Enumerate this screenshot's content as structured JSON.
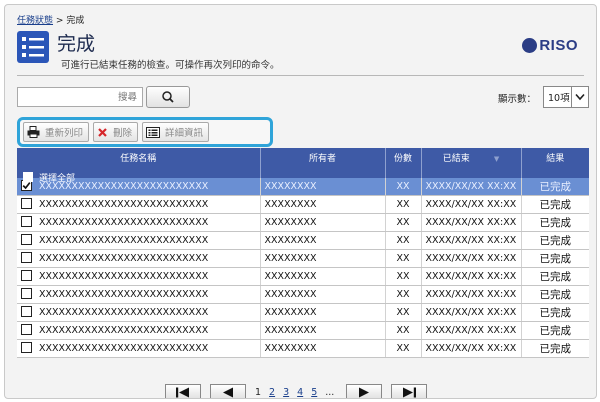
{
  "breadcrumb": {
    "parent": "任務狀態",
    "separator": ">",
    "current": "完成"
  },
  "header": {
    "title": "完成",
    "subtitle": "可進行已結束任務的檢查。可操作再次列印的命令。",
    "logo_text": "RISO",
    "icon": "list-check-icon"
  },
  "search": {
    "placeholder": "搜尋",
    "button_icon": "search-icon"
  },
  "display": {
    "label": "顯示數：",
    "value": "10項"
  },
  "toolbar": {
    "reprint": "重新列印",
    "delete": "刪除",
    "details": "詳細資訊"
  },
  "table": {
    "columns": {
      "name": "任務名稱",
      "owner": "所有者",
      "copies": "份數",
      "ended": "已結束",
      "result": "結果"
    },
    "select_all": "選擇全部",
    "rows": [
      {
        "name": "XXXXXXXXXXXXXXXXXXXXXXXXXX",
        "owner": "XXXXXXXX",
        "copies": "XX",
        "ended": "XXXX/XX/XX XX:XX",
        "result": "已完成",
        "checked": true,
        "selected": true
      },
      {
        "name": "XXXXXXXXXXXXXXXXXXXXXXXXXX",
        "owner": "XXXXXXXX",
        "copies": "XX",
        "ended": "XXXX/XX/XX XX:XX",
        "result": "已完成",
        "checked": false,
        "selected": false
      },
      {
        "name": "XXXXXXXXXXXXXXXXXXXXXXXXXX",
        "owner": "XXXXXXXX",
        "copies": "XX",
        "ended": "XXXX/XX/XX XX:XX",
        "result": "已完成",
        "checked": false,
        "selected": false
      },
      {
        "name": "XXXXXXXXXXXXXXXXXXXXXXXXXX",
        "owner": "XXXXXXXX",
        "copies": "XX",
        "ended": "XXXX/XX/XX XX:XX",
        "result": "已完成",
        "checked": false,
        "selected": false
      },
      {
        "name": "XXXXXXXXXXXXXXXXXXXXXXXXXX",
        "owner": "XXXXXXXX",
        "copies": "XX",
        "ended": "XXXX/XX/XX XX:XX",
        "result": "已完成",
        "checked": false,
        "selected": false
      },
      {
        "name": "XXXXXXXXXXXXXXXXXXXXXXXXXX",
        "owner": "XXXXXXXX",
        "copies": "XX",
        "ended": "XXXX/XX/XX XX:XX",
        "result": "已完成",
        "checked": false,
        "selected": false
      },
      {
        "name": "XXXXXXXXXXXXXXXXXXXXXXXXXX",
        "owner": "XXXXXXXX",
        "copies": "XX",
        "ended": "XXXX/XX/XX XX:XX",
        "result": "已完成",
        "checked": false,
        "selected": false
      },
      {
        "name": "XXXXXXXXXXXXXXXXXXXXXXXXXX",
        "owner": "XXXXXXXX",
        "copies": "XX",
        "ended": "XXXX/XX/XX XX:XX",
        "result": "已完成",
        "checked": false,
        "selected": false
      },
      {
        "name": "XXXXXXXXXXXXXXXXXXXXXXXXXX",
        "owner": "XXXXXXXX",
        "copies": "XX",
        "ended": "XXXX/XX/XX XX:XX",
        "result": "已完成",
        "checked": false,
        "selected": false
      },
      {
        "name": "XXXXXXXXXXXXXXXXXXXXXXXXXX",
        "owner": "XXXXXXXX",
        "copies": "XX",
        "ended": "XXXX/XX/XX XX:XX",
        "result": "已完成",
        "checked": false,
        "selected": false
      }
    ]
  },
  "pager": {
    "current": "1",
    "pages": [
      "2",
      "3",
      "4",
      "5"
    ],
    "ellipsis": "..."
  },
  "colors": {
    "header_blue": "#3e5aa6",
    "selected_row": "#6a8fd3",
    "toolbar_highlight": "#2fa4d9",
    "title_icon": "#2b56b8",
    "logo": "#2b3d85",
    "delete_x": "#d6262b"
  }
}
